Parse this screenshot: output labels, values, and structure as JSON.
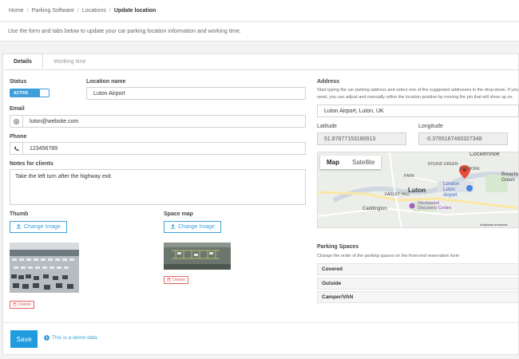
{
  "breadcrumb": {
    "items": [
      "Home",
      "Parking Software",
      "Locations"
    ],
    "current": "Update location"
  },
  "intro": "Use the form and tabs below to update your car parking location information and working time.",
  "tabs": [
    {
      "label": "Details",
      "active": true
    },
    {
      "label": "Working time",
      "active": false
    }
  ],
  "form": {
    "status": {
      "label": "Status",
      "value": "ACTIVE"
    },
    "location_name": {
      "label": "Location name",
      "value": "Luton Airport"
    },
    "email": {
      "label": "Email",
      "value": "luton@website.com",
      "icon": "at-icon"
    },
    "phone": {
      "label": "Phone",
      "value": "123456789",
      "icon": "phone-icon"
    },
    "notes": {
      "label": "Notes for clients",
      "value": "Take the left turn after the highway exit."
    },
    "thumb": {
      "label": "Thumb",
      "change_label": "Change Image",
      "delete_label": "Delete"
    },
    "space_map": {
      "label": "Space map",
      "change_label": "Change Image",
      "delete_label": "Delete"
    }
  },
  "address": {
    "label": "Address",
    "hint": "Start typing the car parking address and select one of the suggested addresses in the drop-down. If you need, you can adjust and manually refine the location position by moving the pin that will show up on the map.",
    "value": "Luton Airport, Luton, UK",
    "latitude": {
      "label": "Latitude",
      "value": "51.87877153180913"
    },
    "longitude": {
      "label": "Longitude",
      "value": "-0.3765167460327348"
    }
  },
  "map": {
    "buttons": [
      "Map",
      "Satellite"
    ],
    "labels": [
      "Cockernhoe",
      "Breachwood Green",
      "WIGMORE",
      "ROUND GREEN",
      "PARK",
      "FARLEY HILL",
      "Luton",
      "London Luton Airport",
      "Caddington",
      "Stockwood Discovery Centre",
      "Keyboard shortcuts"
    ]
  },
  "parking_spaces": {
    "label": "Parking Spaces",
    "hint": "Change the order of the parking spaces on the front-end reservation form",
    "items": [
      "Covered",
      "Outside",
      "Camper/VAN"
    ]
  },
  "footer": {
    "save_label": "Save",
    "demo_label": "This is a demo data"
  },
  "colors": {
    "accent": "#1f9bde",
    "danger": "#e06060",
    "map_pin": "#e84a3c"
  }
}
